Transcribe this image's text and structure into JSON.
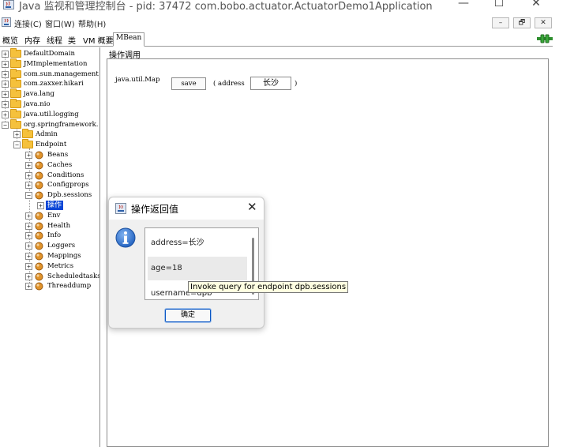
{
  "window": {
    "title": "Java 监视和管理控制台 - pid: 37472 com.bobo.actuator.ActuatorDemo1Application",
    "minimize": "—",
    "maximize": "☐",
    "close": "✕"
  },
  "menu": {
    "items": [
      "连接(C)",
      "窗口(W)",
      "帮助(H)"
    ],
    "mdi_buttons": [
      "–",
      "🗗",
      "✕"
    ]
  },
  "tabs": [
    "概览",
    "内存",
    "线程",
    "类",
    "VM 概要",
    "MBean"
  ],
  "active_tab": "MBean",
  "tree": {
    "top_level": [
      "DefaultDomain",
      "JMImplementation",
      "com.sun.management",
      "com.zaxxer.hikari",
      "java.lang",
      "java.nio",
      "java.util.logging",
      "org.springframework."
    ],
    "org_children": [
      "Admin",
      "Endpoint"
    ],
    "endpoint_children": [
      "Beans",
      "Caches",
      "Conditions",
      "Configprops",
      "Dpb.sessions",
      "Env",
      "Health",
      "Info",
      "Loggers",
      "Mappings",
      "Metrics",
      "Scheduledtasks",
      "Threaddump"
    ],
    "selected": "操作"
  },
  "panel": {
    "title": "操作调用",
    "return_type": "java.util.Map",
    "button_label": "save",
    "paren_open": "( address",
    "param_value": "长沙",
    "paren_close": ")"
  },
  "dialog": {
    "title": "操作返回值",
    "close": "✕",
    "rows": [
      "address=长沙",
      "age=18",
      "username=dpb"
    ],
    "ok_label": "确定"
  },
  "tooltip": "Invoke query for endpoint dpb.sessions",
  "colors": {
    "selection": "#0a46d6",
    "folder": "#f5c13c",
    "tooltip_bg": "#ffffe1",
    "info_blue": "#1f5fbf"
  }
}
